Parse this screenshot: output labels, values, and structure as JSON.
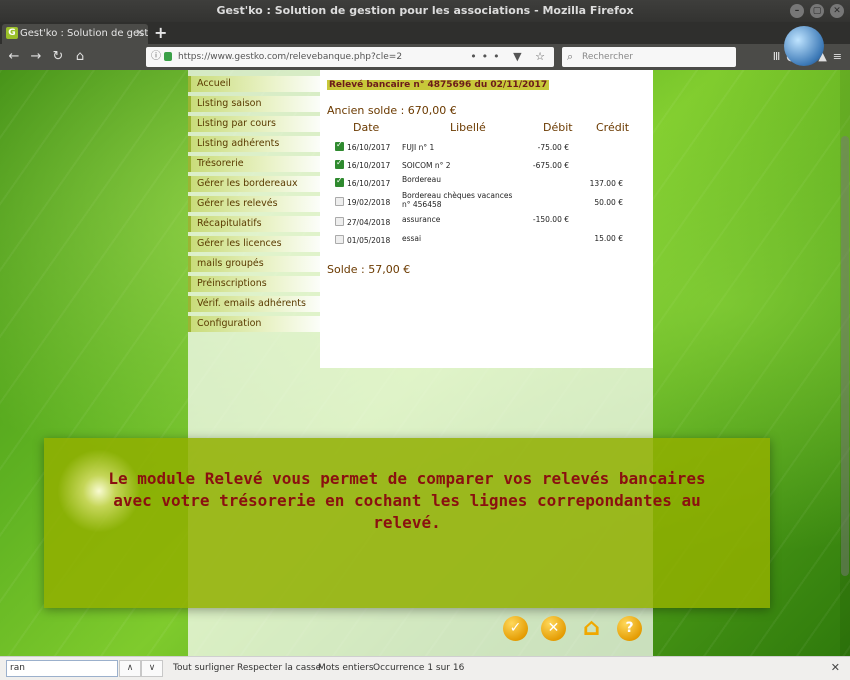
{
  "window": {
    "title": "Gest'ko : Solution de gestion pour les associations - Mozilla Firefox"
  },
  "tab": {
    "title": "Gest'ko : Solution de gestion"
  },
  "nav": {
    "url": "https://www.gestko.com/relevebanque.php?cle=2",
    "search_placeholder": "Rechercher"
  },
  "menu": {
    "items": [
      "Accueil",
      "Listing saison",
      "Listing par cours",
      "Listing adhérents",
      "Trésorerie",
      "Gérer les bordereaux",
      "Gérer les relevés",
      "Récapitulatifs",
      "Gérer les licences",
      "mails groupés",
      "Préinscriptions",
      "Vérif. emails adhérents",
      "Configuration"
    ]
  },
  "statement": {
    "title": "Relevé bancaire n° 4875696 du 02/11/2017",
    "ancien_solde": "Ancien solde : 670,00 €",
    "headers": {
      "date": "Date",
      "libelle": "Libellé",
      "debit": "Débit",
      "credit": "Crédit"
    },
    "rows": [
      {
        "checked": true,
        "date": "16/10/2017",
        "libelle": "FUJI n° 1",
        "debit": "-75.00 €",
        "credit": ""
      },
      {
        "checked": true,
        "date": "16/10/2017",
        "libelle": "SOICOM n° 2",
        "debit": "-675.00 €",
        "credit": ""
      },
      {
        "checked": true,
        "date": "16/10/2017",
        "libelle": "Bordereau",
        "debit": "",
        "credit": "137.00 €"
      },
      {
        "checked": false,
        "date": "19/02/2018",
        "libelle": "Bordereau chèques vacances n° 456458",
        "debit": "",
        "credit": "50.00 €"
      },
      {
        "checked": false,
        "date": "27/04/2018",
        "libelle": "assurance",
        "debit": "-150.00 €",
        "credit": ""
      },
      {
        "checked": false,
        "date": "01/05/2018",
        "libelle": "essai",
        "debit": "",
        "credit": "15.00 €"
      }
    ],
    "solde": "Solde : 57,00 €"
  },
  "caption": {
    "text": "Le module Relevé vous permet de comparer vos relevés bancaires avec votre trésorerie en cochant les lignes correpondantes au relevé."
  },
  "findbar": {
    "value": "ran",
    "highlight_all": "Tout surligner",
    "match_case": "Respecter la casse",
    "whole_words": "Mots entiers",
    "status": "Occurrence 1 sur 16"
  },
  "colors": {
    "menu_text": "#5a3a00",
    "caption_text": "#8a1010",
    "caption_bg": "#91af00",
    "accent": "#e39a00"
  }
}
